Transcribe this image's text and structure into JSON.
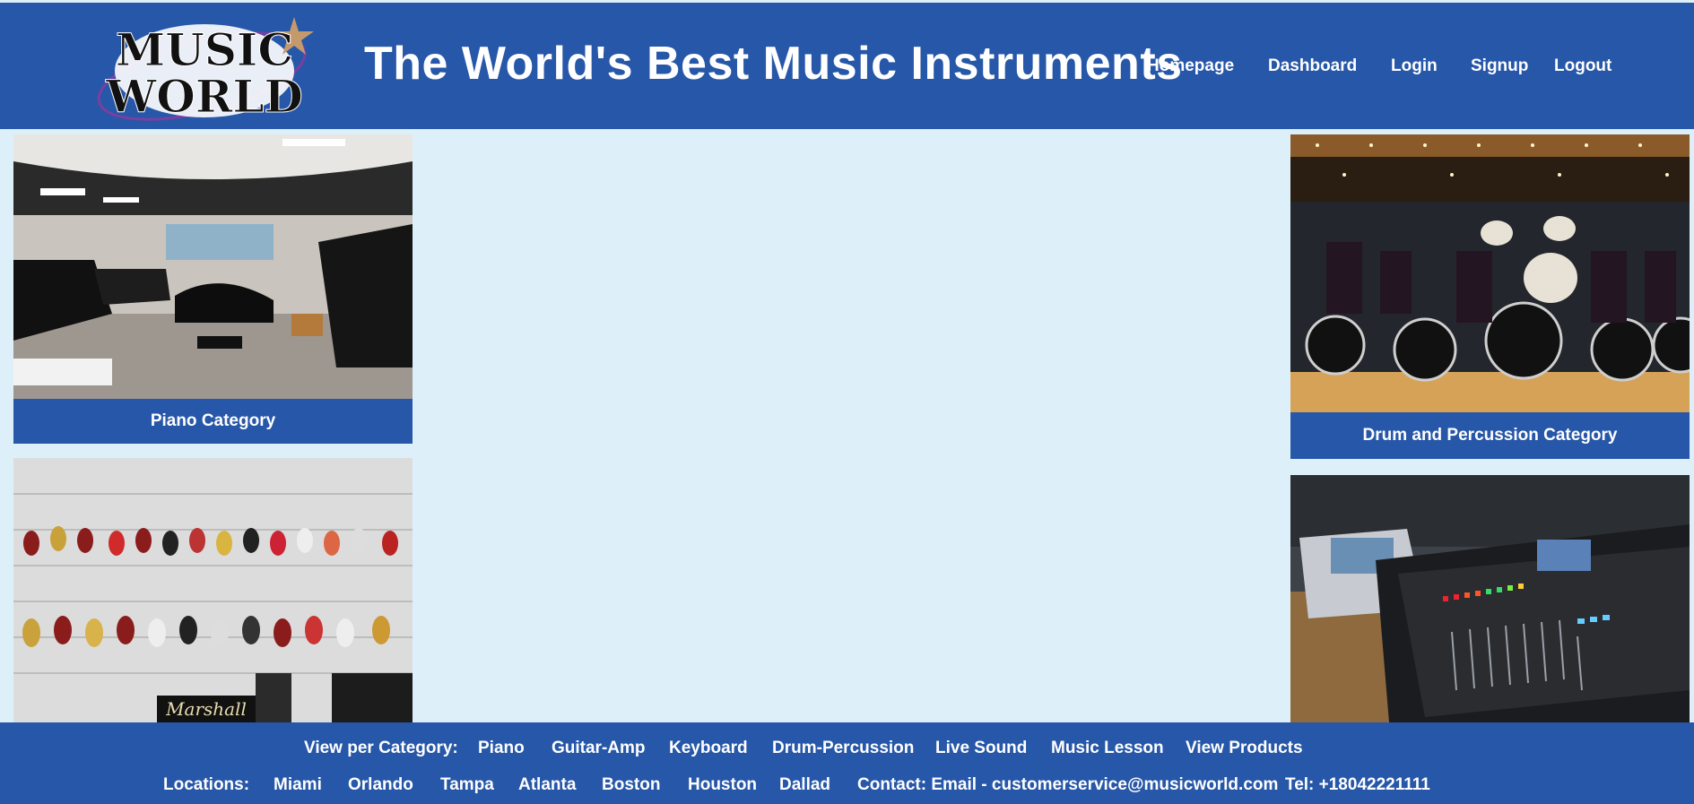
{
  "header": {
    "logo_text_line1": "MUSIC",
    "logo_text_line2": "WORLD",
    "title": "The World's Best Music Instruments",
    "nav": [
      "Homepage",
      "Dashboard",
      "Login",
      "Signup",
      "Logout"
    ]
  },
  "categories": {
    "piano": "Piano Category",
    "drum": "Drum and Percussion Category"
  },
  "footer": {
    "category_label": "View per Category:",
    "category_links": [
      "Piano",
      "Guitar-Amp",
      "Keyboard",
      "Drum-Percussion",
      "Live Sound",
      "Music Lesson",
      "View Products"
    ],
    "locations_label": "Locations:",
    "locations": [
      "Miami",
      "Orlando",
      "Tampa",
      "Atlanta",
      "Boston",
      "Houston",
      "Dallad"
    ],
    "contact": "Contact: Email - customerservice@musicworld.com",
    "phone": "Tel: +18042221111"
  },
  "colors": {
    "header_bg": "#2757a8",
    "page_bg": "#ddf0fa",
    "text": "#ffffff"
  }
}
